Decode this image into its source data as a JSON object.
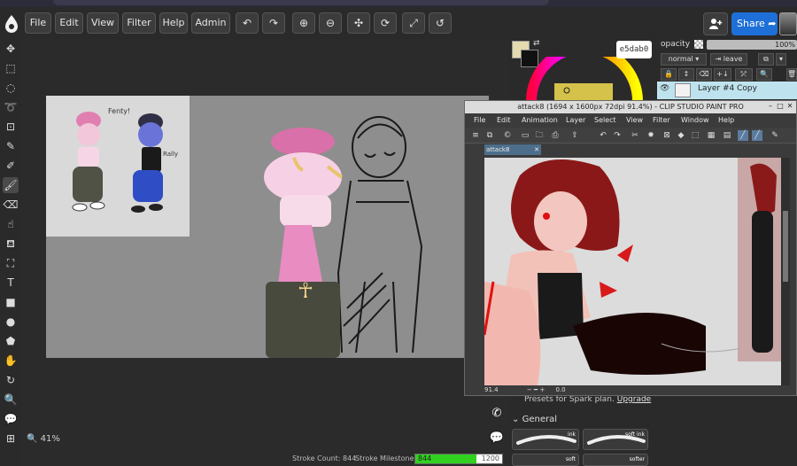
{
  "menu": {
    "file": "File",
    "edit": "Edit",
    "view": "View",
    "filter": "Filter",
    "help": "Help",
    "admin": "Admin"
  },
  "share": {
    "label": "Share"
  },
  "color": {
    "hex": "e5dab0",
    "primary": "#e5dab0",
    "secondary": "#111111"
  },
  "layers": {
    "opacity_label": "opacity",
    "opacity_value": "100%",
    "blend_mode": "normal",
    "leave_label": "leave",
    "selected_layer": "Layer #4 Copy"
  },
  "canvas": {
    "zoom": "41%"
  },
  "status": {
    "stroke_count": "Stroke Count: 844",
    "stroke_milestone_label": "Stroke Milestone:",
    "milestone_current": "844",
    "milestone_goal": "1200"
  },
  "brushes": {
    "presets_text": "Presets for Spark plan.",
    "upgrade": "Upgrade",
    "group": "General",
    "items": [
      "ink",
      "soft ink",
      "soft",
      "softer"
    ]
  },
  "csp": {
    "title": "attack8 (1694 x 1600px 72dpi 91.4%) - CLIP STUDIO PAINT PRO",
    "menu": [
      "File",
      "Edit",
      "Animation",
      "Layer",
      "Select",
      "View",
      "Filter",
      "Window",
      "Help"
    ],
    "tab": "attack8",
    "zoom": "91.4",
    "angle": "0.0"
  },
  "sketch_notes": {
    "left": "Fenty!",
    "right": "Rally"
  }
}
